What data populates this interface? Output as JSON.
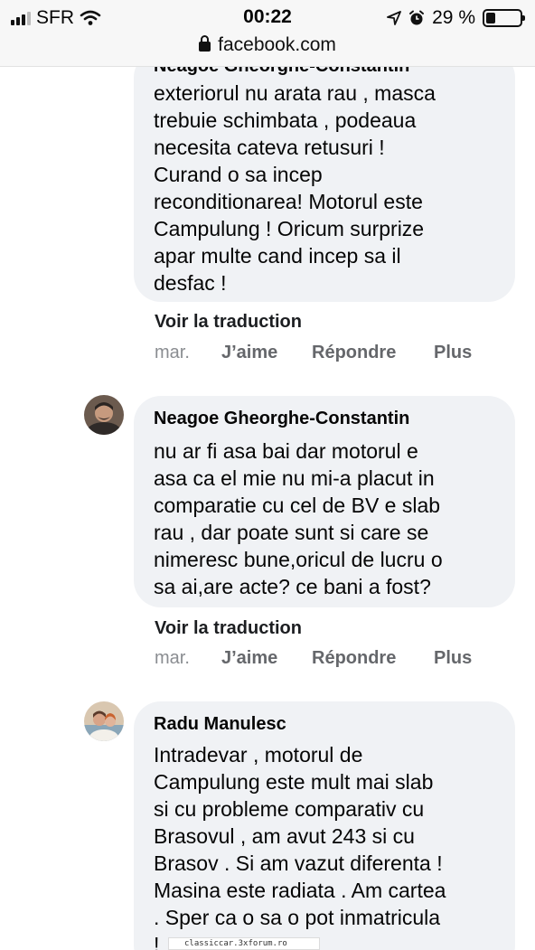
{
  "status_bar": {
    "carrier": "SFR",
    "time": "00:22",
    "battery_percent": "29 %",
    "battery_level": 0.29,
    "url": "facebook.com"
  },
  "comments": [
    {
      "author": "Neagoe Gheorghe-Constantin",
      "text": "exteriorul nu arata rau , masca\ntrebuie schimbata , podeaua\nnecesita cateva retusuri !\nCurand o sa incep\nreconditionarea! Motorul este\nCampulung ! Oricum surprize\napar multe cand incep sa il\ndesfac !",
      "translate": "Voir la traduction",
      "time": "mar.",
      "like": "J’aime",
      "reply": "Répondre",
      "more": "Plus"
    },
    {
      "author": "Neagoe Gheorghe-Constantin",
      "text": "nu ar fi asa bai dar motorul e\nasa ca el mie nu mi-a placut in\ncomparatie cu cel de BV e slab\nrau , dar poate sunt si care se\nnimeresc bune,oricul de lucru o\nsa ai,are acte? ce bani a fost?",
      "translate": "Voir la traduction",
      "time": "mar.",
      "like": "J’aime",
      "reply": "Répondre",
      "more": "Plus"
    },
    {
      "author": "Radu Manulesc",
      "text": "Intradevar , motorul de\nCampulung este mult mai slab\nsi cu probleme comparativ cu\nBrasovul , am avut 243 si cu\nBrasov . Si am vazut diferenta !\nMasina este radiata . Am cartea\n. Sper ca o sa o pot inmatricula\n!"
    }
  ],
  "watermark": "classiccar.3xforum.ro"
}
